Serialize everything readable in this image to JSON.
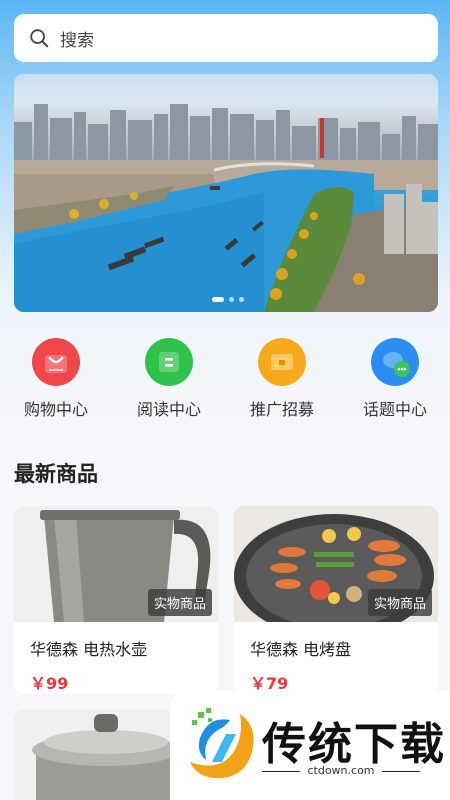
{
  "search": {
    "placeholder": "搜索"
  },
  "banner": {
    "dot_count": 3,
    "active_dot": 0
  },
  "menu": [
    {
      "label": "购物中心",
      "icon": "shopping-bag-icon",
      "color": "#f0474b"
    },
    {
      "label": "阅读中心",
      "icon": "reading-icon",
      "color": "#2fc24a"
    },
    {
      "label": "推广招募",
      "icon": "promotion-icon",
      "color": "#f7a81b"
    },
    {
      "label": "话题中心",
      "icon": "topic-chat-icon",
      "color": "#2a8ef0"
    }
  ],
  "section": {
    "title": "最新商品"
  },
  "products": [
    {
      "name": "华德森 电热水壶",
      "price": "￥99",
      "tag": "实物商品"
    },
    {
      "name": "华德森 电烤盘",
      "price": "￥79",
      "tag": "实物商品"
    },
    {
      "name": "",
      "price": "",
      "tag": ""
    }
  ],
  "watermark": {
    "brand": "传统下载",
    "url": "ctdown.com"
  }
}
